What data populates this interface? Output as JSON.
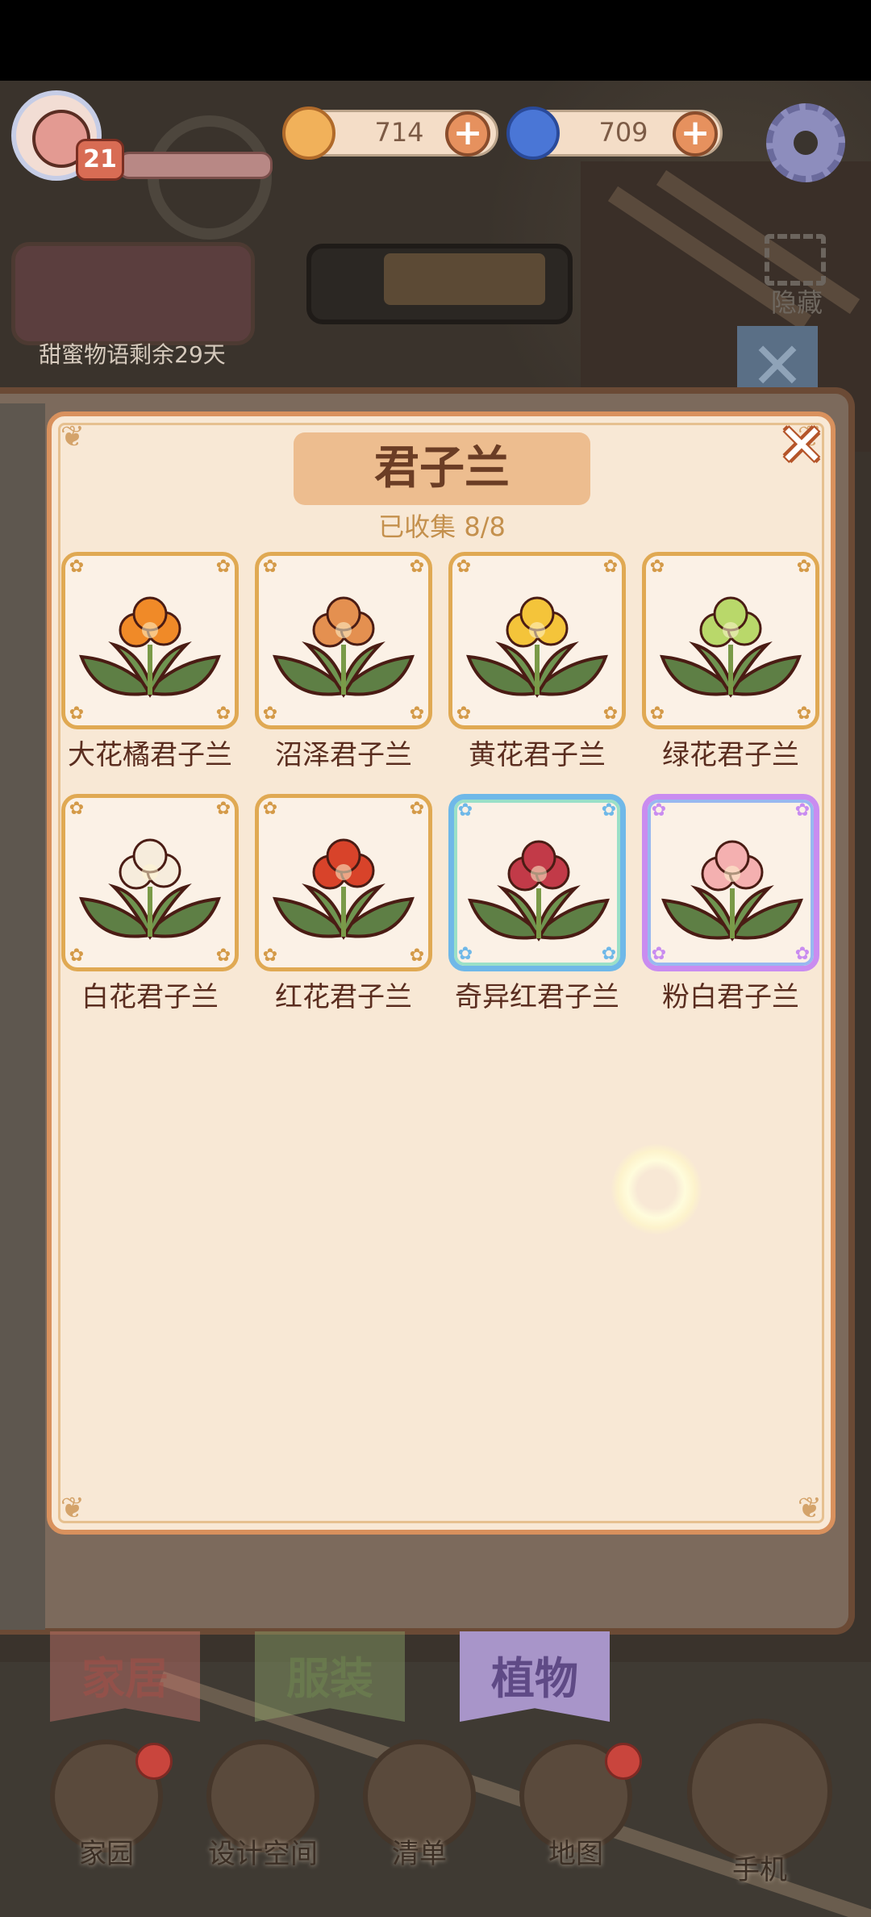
{
  "hud": {
    "level": "21",
    "currency_gold": "714",
    "currency_blue": "709",
    "plus_symbol": "+"
  },
  "event": {
    "text": "甜蜜物语剩余29天"
  },
  "hide_label": "隐藏",
  "dim_close_symbol": "✕",
  "panel": {
    "title": "君子兰",
    "collected": "已收集  8/8",
    "close_symbol": "✕",
    "items": [
      {
        "name": "大花橘君子兰",
        "petal_color": "#f08a28",
        "rarity": "normal"
      },
      {
        "name": "沼泽君子兰",
        "petal_color": "#e49050",
        "rarity": "normal"
      },
      {
        "name": "黄花君子兰",
        "petal_color": "#f4c43a",
        "rarity": "normal"
      },
      {
        "name": "绿花君子兰",
        "petal_color": "#b9d86a",
        "rarity": "normal"
      },
      {
        "name": "白花君子兰",
        "petal_color": "#f6ecdc",
        "rarity": "normal"
      },
      {
        "name": "红花君子兰",
        "petal_color": "#d8432a",
        "rarity": "normal"
      },
      {
        "name": "奇异红君子兰",
        "petal_color": "#c23a48",
        "rarity": "rare"
      },
      {
        "name": "粉白君子兰",
        "petal_color": "#f4b0b0",
        "rarity": "epic"
      }
    ]
  },
  "tabs": [
    {
      "label": "家居",
      "color": "#c9776e",
      "text_color": "#a35048",
      "active": false
    },
    {
      "label": "服装",
      "color": "#8ea56b",
      "text_color": "#6e8550",
      "active": false
    },
    {
      "label": "植物",
      "color": "#a895c9",
      "text_color": "#5f4a86",
      "active": true
    }
  ],
  "dock": [
    {
      "label": "家园",
      "has_badge": true
    },
    {
      "label": "设计空间",
      "has_badge": false
    },
    {
      "label": "清单",
      "has_badge": false
    },
    {
      "label": "地图",
      "has_badge": true
    },
    {
      "label": "手机",
      "has_badge": false
    }
  ],
  "colors": {
    "panel_bg": "#f8e8d5",
    "panel_border": "#d9915d",
    "title_bg": "#edbd8f",
    "rare_border": "#6fb8e8",
    "epic_border": "#c98cf0"
  }
}
